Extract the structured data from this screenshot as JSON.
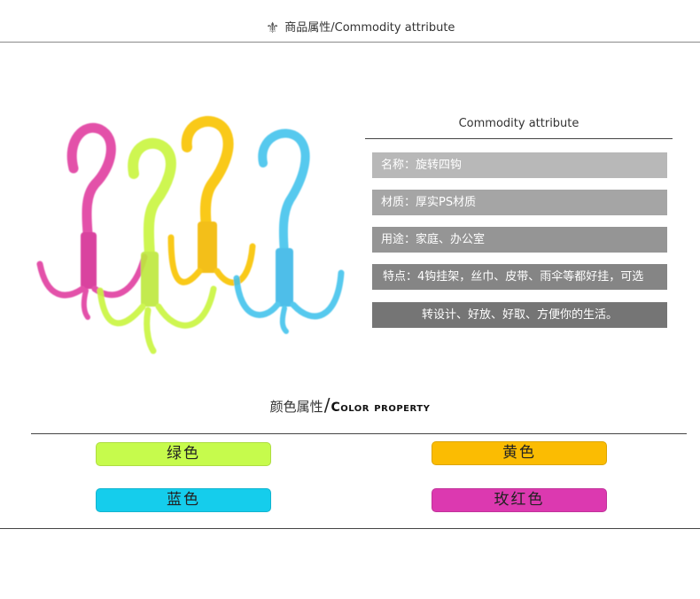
{
  "header": {
    "title": "商品属性/Commodity attribute",
    "icon": "fleur-de-lis-icon"
  },
  "attributes": {
    "heading": "Commodity attribute",
    "items": [
      "名称：旋转四钩",
      "材质：厚实PS材质",
      "用途：家庭、办公室",
      "特点：4钩挂架，丝巾、皮带、雨伞等都好挂，可选",
      "转设计、好放、好取、方便你的生活。"
    ]
  },
  "color_section": {
    "title_cn": "颜色属性",
    "slash": "/",
    "title_en": "Color property"
  },
  "colors": [
    {
      "label": "绿色",
      "hex": "#c6fb4c"
    },
    {
      "label": "黄色",
      "hex": "#fbbc02"
    },
    {
      "label": "蓝色",
      "hex": "#15cdec"
    },
    {
      "label": "玫红色",
      "hex": "#dc39b0"
    }
  ],
  "hook_colors": {
    "pink": "#e0389e",
    "green": "#c9f53f",
    "yellow": "#f9c400",
    "blue": "#3fc2ec"
  }
}
